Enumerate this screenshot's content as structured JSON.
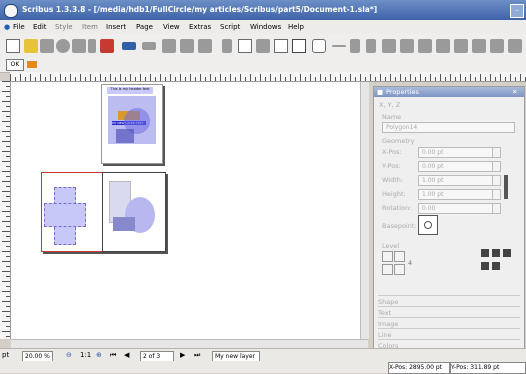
{
  "window": {
    "title": "Scribus 1.3.3.8 - [/media/hdb1/FullCircle/my articles/Scribus/part5/Document-1.sla*]"
  },
  "menu": [
    "File",
    "Edit",
    "Style",
    "Item",
    "Insert",
    "Page",
    "View",
    "Extras",
    "Script",
    "Windows",
    "Help"
  ],
  "toolbar2": {
    "ok_label": "OK"
  },
  "statusbar": {
    "unit": "pt",
    "zoom": "20.00 %",
    "ratio": "1:1",
    "page": "2 of 3",
    "layer": "My new layer",
    "xpos": "X-Pos: 2895.00 pt",
    "ypos": "Y-Pos: 311.89 pt"
  },
  "properties": {
    "title": "Properties",
    "section_xyz": "X, Y, Z",
    "name_label": "Name",
    "name_value": "Polygon14",
    "geometry_label": "Geometry",
    "xpos_label": "X-Pos:",
    "xpos_value": "0.00 pt",
    "ypos_label": "Y-Pos:",
    "ypos_value": "0.00 pt",
    "width_label": "Width:",
    "width_value": "1.00 pt",
    "height_label": "Height:",
    "height_value": "1.00 pt",
    "rotation_label": "Rotation:",
    "rotation_value": "0.00",
    "basepoint_label": "Basepoint:",
    "level_label": "Level",
    "level_value": "4",
    "sections": [
      "Shape",
      "Text",
      "Image",
      "Line",
      "Colors"
    ]
  },
  "page1": {
    "heading": "This is my header text",
    "subheading": "MY NEW LAYER TEXT"
  }
}
